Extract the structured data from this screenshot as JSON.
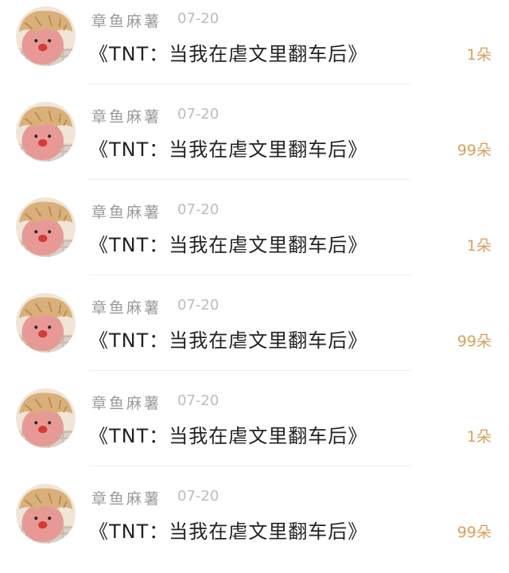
{
  "colors": {
    "username": "#9a9a9a",
    "date": "#bcbcbc",
    "title": "#222222",
    "count_accent": "#d9a05b",
    "divider": "#eeeeee",
    "avatar_hat": "#d9b07a",
    "avatar_face": "#e79a95",
    "avatar_nose": "#d63a33"
  },
  "avatar_icon": "bread-hat-plush-avatar",
  "items": [
    {
      "username": "章鱼麻薯",
      "date": "07-20",
      "title": "《TNT：当我在虐文里翻车后》",
      "count": "1朵"
    },
    {
      "username": "章鱼麻薯",
      "date": "07-20",
      "title": "《TNT：当我在虐文里翻车后》",
      "count": "99朵"
    },
    {
      "username": "章鱼麻薯",
      "date": "07-20",
      "title": "《TNT：当我在虐文里翻车后》",
      "count": "1朵"
    },
    {
      "username": "章鱼麻薯",
      "date": "07-20",
      "title": "《TNT：当我在虐文里翻车后》",
      "count": "99朵"
    },
    {
      "username": "章鱼麻薯",
      "date": "07-20",
      "title": "《TNT：当我在虐文里翻车后》",
      "count": "1朵"
    },
    {
      "username": "章鱼麻薯",
      "date": "07-20",
      "title": "《TNT：当我在虐文里翻车后》",
      "count": "99朵"
    }
  ]
}
